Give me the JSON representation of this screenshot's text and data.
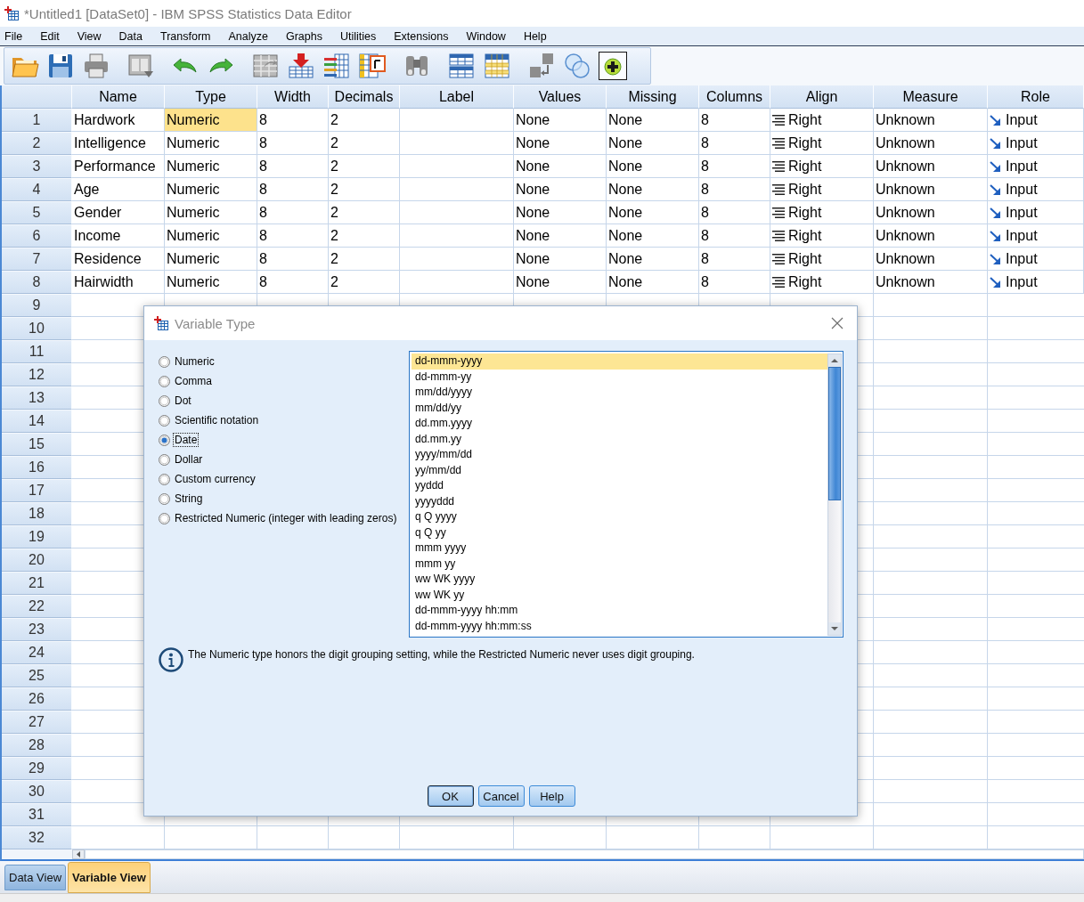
{
  "window": {
    "title": "*Untitled1 [DataSet0] - IBM SPSS Statistics Data Editor"
  },
  "menu": [
    "File",
    "Edit",
    "View",
    "Data",
    "Transform",
    "Analyze",
    "Graphs",
    "Utilities",
    "Extensions",
    "Window",
    "Help"
  ],
  "toolbar": [
    {
      "buttons": [
        {
          "disabled": false,
          "pressed": false
        },
        {
          "disabled": false,
          "pressed": false
        },
        {
          "disabled": true,
          "pressed": false
        }
      ]
    },
    {
      "buttons": [
        {
          "disabled": true,
          "pressed": false
        }
      ]
    },
    {
      "buttons": [
        {
          "disabled": false,
          "pressed": false
        },
        {
          "disabled": false,
          "pressed": false
        }
      ]
    },
    {
      "buttons": [
        {
          "disabled": true,
          "pressed": false
        },
        {
          "disabled": false,
          "pressed": false
        },
        {
          "disabled": false,
          "pressed": false
        },
        {
          "disabled": false,
          "pressed": false
        }
      ]
    },
    {
      "buttons": [
        {
          "disabled": true,
          "pressed": false
        }
      ]
    },
    {
      "buttons": [
        {
          "disabled": false,
          "pressed": false
        },
        {
          "disabled": false,
          "pressed": false
        }
      ]
    },
    {
      "buttons": [
        {
          "disabled": true,
          "pressed": false
        },
        {
          "disabled": false,
          "pressed": false
        },
        {
          "disabled": false,
          "pressed": true
        }
      ]
    }
  ],
  "grid": {
    "columns": [
      {
        "label": "Name",
        "kind": "text"
      },
      {
        "label": "Type",
        "kind": "text"
      },
      {
        "label": "Width",
        "kind": "text"
      },
      {
        "label": "Decimals",
        "kind": "text"
      },
      {
        "label": "Label",
        "kind": "text"
      },
      {
        "label": "Values",
        "kind": "text"
      },
      {
        "label": "Missing",
        "kind": "text"
      },
      {
        "label": "Columns",
        "kind": "text"
      },
      {
        "label": "Align",
        "kind": "align"
      },
      {
        "label": "Measure",
        "kind": "text"
      },
      {
        "label": "Role",
        "kind": "role"
      }
    ],
    "rows": [
      {
        "number": "1",
        "cells": [
          {
            "text": "Hardwork",
            "selected": false
          },
          {
            "text": "Numeric",
            "selected": true
          },
          {
            "text": "8",
            "selected": false
          },
          {
            "text": "2",
            "selected": false
          },
          {
            "selected": false
          },
          {
            "text": "None",
            "selected": false
          },
          {
            "text": "None",
            "selected": false
          },
          {
            "text": "8",
            "selected": false
          },
          {
            "text": "Right",
            "selected": false
          },
          {
            "text": "Unknown",
            "selected": false
          },
          {
            "text": "Input",
            "selected": false
          }
        ]
      },
      {
        "number": "2",
        "cells": [
          {
            "text": "Intelligence",
            "selected": false
          },
          {
            "text": "Numeric",
            "selected": false
          },
          {
            "text": "8",
            "selected": false
          },
          {
            "text": "2",
            "selected": false
          },
          {
            "selected": false
          },
          {
            "text": "None",
            "selected": false
          },
          {
            "text": "None",
            "selected": false
          },
          {
            "text": "8",
            "selected": false
          },
          {
            "text": "Right",
            "selected": false
          },
          {
            "text": "Unknown",
            "selected": false
          },
          {
            "text": "Input",
            "selected": false
          }
        ]
      },
      {
        "number": "3",
        "cells": [
          {
            "text": "Performance",
            "selected": false
          },
          {
            "text": "Numeric",
            "selected": false
          },
          {
            "text": "8",
            "selected": false
          },
          {
            "text": "2",
            "selected": false
          },
          {
            "selected": false
          },
          {
            "text": "None",
            "selected": false
          },
          {
            "text": "None",
            "selected": false
          },
          {
            "text": "8",
            "selected": false
          },
          {
            "text": "Right",
            "selected": false
          },
          {
            "text": "Unknown",
            "selected": false
          },
          {
            "text": "Input",
            "selected": false
          }
        ]
      },
      {
        "number": "4",
        "cells": [
          {
            "text": "Age",
            "selected": false
          },
          {
            "text": "Numeric",
            "selected": false
          },
          {
            "text": "8",
            "selected": false
          },
          {
            "text": "2",
            "selected": false
          },
          {
            "selected": false
          },
          {
            "text": "None",
            "selected": false
          },
          {
            "text": "None",
            "selected": false
          },
          {
            "text": "8",
            "selected": false
          },
          {
            "text": "Right",
            "selected": false
          },
          {
            "text": "Unknown",
            "selected": false
          },
          {
            "text": "Input",
            "selected": false
          }
        ]
      },
      {
        "number": "5",
        "cells": [
          {
            "text": "Gender",
            "selected": false
          },
          {
            "text": "Numeric",
            "selected": false
          },
          {
            "text": "8",
            "selected": false
          },
          {
            "text": "2",
            "selected": false
          },
          {
            "selected": false
          },
          {
            "text": "None",
            "selected": false
          },
          {
            "text": "None",
            "selected": false
          },
          {
            "text": "8",
            "selected": false
          },
          {
            "text": "Right",
            "selected": false
          },
          {
            "text": "Unknown",
            "selected": false
          },
          {
            "text": "Input",
            "selected": false
          }
        ]
      },
      {
        "number": "6",
        "cells": [
          {
            "text": "Income",
            "selected": false
          },
          {
            "text": "Numeric",
            "selected": false
          },
          {
            "text": "8",
            "selected": false
          },
          {
            "text": "2",
            "selected": false
          },
          {
            "selected": false
          },
          {
            "text": "None",
            "selected": false
          },
          {
            "text": "None",
            "selected": false
          },
          {
            "text": "8",
            "selected": false
          },
          {
            "text": "Right",
            "selected": false
          },
          {
            "text": "Unknown",
            "selected": false
          },
          {
            "text": "Input",
            "selected": false
          }
        ]
      },
      {
        "number": "7",
        "cells": [
          {
            "text": "Residence",
            "selected": false
          },
          {
            "text": "Numeric",
            "selected": false
          },
          {
            "text": "8",
            "selected": false
          },
          {
            "text": "2",
            "selected": false
          },
          {
            "selected": false
          },
          {
            "text": "None",
            "selected": false
          },
          {
            "text": "None",
            "selected": false
          },
          {
            "text": "8",
            "selected": false
          },
          {
            "text": "Right",
            "selected": false
          },
          {
            "text": "Unknown",
            "selected": false
          },
          {
            "text": "Input",
            "selected": false
          }
        ]
      },
      {
        "number": "8",
        "cells": [
          {
            "text": "Hairwidth",
            "selected": false
          },
          {
            "text": "Numeric",
            "selected": false
          },
          {
            "text": "8",
            "selected": false
          },
          {
            "text": "2",
            "selected": false
          },
          {
            "selected": false
          },
          {
            "text": "None",
            "selected": false
          },
          {
            "text": "None",
            "selected": false
          },
          {
            "text": "8",
            "selected": false
          },
          {
            "text": "Right",
            "selected": false
          },
          {
            "text": "Unknown",
            "selected": false
          },
          {
            "text": "Input",
            "selected": false
          }
        ]
      },
      {
        "number": "9"
      },
      {
        "number": "10"
      },
      {
        "number": "11"
      },
      {
        "number": "12"
      },
      {
        "number": "13"
      },
      {
        "number": "14"
      },
      {
        "number": "15"
      },
      {
        "number": "16"
      },
      {
        "number": "17"
      },
      {
        "number": "18"
      },
      {
        "number": "19"
      },
      {
        "number": "20"
      },
      {
        "number": "21"
      },
      {
        "number": "22"
      },
      {
        "number": "23"
      },
      {
        "number": "24"
      },
      {
        "number": "25"
      },
      {
        "number": "26"
      },
      {
        "number": "27"
      },
      {
        "number": "28"
      },
      {
        "number": "29"
      },
      {
        "number": "30"
      },
      {
        "number": "31"
      },
      {
        "number": "32"
      }
    ]
  },
  "view_tabs": [
    {
      "label": "Data View",
      "selected": false
    },
    {
      "label": "Variable View",
      "selected": true
    }
  ],
  "dialog": {
    "title": "Variable Type",
    "types": [
      {
        "label": "Numeric",
        "selected": false,
        "focused": false
      },
      {
        "label": "Comma",
        "selected": false,
        "focused": false
      },
      {
        "label": "Dot",
        "selected": false,
        "focused": false
      },
      {
        "label": "Scientific notation",
        "selected": false,
        "focused": false
      },
      {
        "label": "Date",
        "selected": true,
        "focused": true
      },
      {
        "label": "Dollar",
        "selected": false,
        "focused": false
      },
      {
        "label": "Custom currency",
        "selected": false,
        "focused": false
      },
      {
        "label": "String",
        "selected": false,
        "focused": false
      },
      {
        "label": "Restricted Numeric (integer with leading zeros)",
        "selected": false,
        "focused": false
      }
    ],
    "formats": [
      {
        "label": "dd-mmm-yyyy",
        "selected": true
      },
      {
        "label": "dd-mmm-yy",
        "selected": false
      },
      {
        "label": "mm/dd/yyyy",
        "selected": false
      },
      {
        "label": "mm/dd/yy",
        "selected": false
      },
      {
        "label": "dd.mm.yyyy",
        "selected": false
      },
      {
        "label": "dd.mm.yy",
        "selected": false
      },
      {
        "label": "yyyy/mm/dd",
        "selected": false
      },
      {
        "label": "yy/mm/dd",
        "selected": false
      },
      {
        "label": "yyddd",
        "selected": false
      },
      {
        "label": "yyyyddd",
        "selected": false
      },
      {
        "label": "q Q yyyy",
        "selected": false
      },
      {
        "label": "q Q yy",
        "selected": false
      },
      {
        "label": "mmm yyyy",
        "selected": false
      },
      {
        "label": "mmm yy",
        "selected": false
      },
      {
        "label": "ww WK yyyy",
        "selected": false
      },
      {
        "label": "ww WK yy",
        "selected": false
      },
      {
        "label": "dd-mmm-yyyy hh:mm",
        "selected": false
      },
      {
        "label": "dd-mmm-yyyy hh:mm:ss",
        "selected": false
      }
    ],
    "note": "The Numeric type honors the digit grouping setting, while the Restricted Numeric never uses digit grouping.",
    "buttons": [
      {
        "label": "OK",
        "default": true
      },
      {
        "label": "Cancel",
        "default": false
      },
      {
        "label": "Help",
        "default": false
      }
    ]
  }
}
